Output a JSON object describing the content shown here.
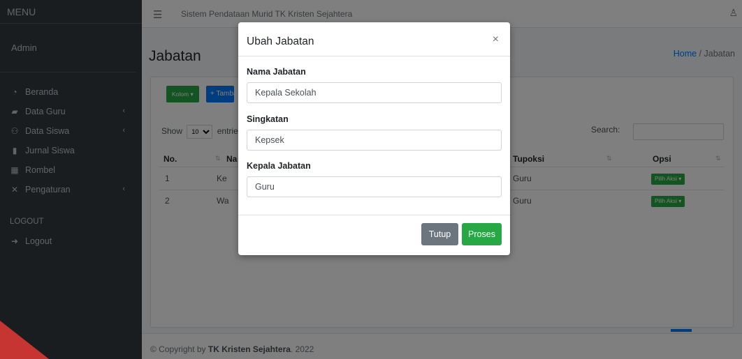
{
  "sidebar": {
    "menu_label": "MENU",
    "user": "Admin",
    "items": [
      {
        "label": "Beranda",
        "icon": "tachometer-icon",
        "chevron": ""
      },
      {
        "label": "Data Guru",
        "icon": "chalkboard-teacher-icon",
        "chevron": "‹"
      },
      {
        "label": "Data Siswa",
        "icon": "users-icon",
        "chevron": "‹"
      },
      {
        "label": "Jurnal Siswa",
        "icon": "file-icon",
        "chevron": ""
      },
      {
        "label": "Rombel",
        "icon": "building-icon",
        "chevron": ""
      },
      {
        "label": "Pengaturan",
        "icon": "tools-icon",
        "chevron": "‹"
      }
    ],
    "logout_header": "LOGOUT",
    "logout_label": "Logout"
  },
  "topbar": {
    "title": "Sistem Pendataan Murid TK Kristen Sejahtera"
  },
  "page": {
    "title": "Jabatan",
    "breadcrumb_home": "Home",
    "breadcrumb_sep": "/",
    "breadcrumb_current": "Jabatan"
  },
  "toolbar": {
    "kolom_label": "Kolom ▾",
    "tambah_label": "+ Tambah"
  },
  "table": {
    "show_label": "Show",
    "entries_value": "10",
    "entries_label": "entries",
    "search_label": "Search:",
    "headers": {
      "no": "No.",
      "nama": "Na",
      "tupoksi": "Tupoksi",
      "opsi": "Opsi"
    },
    "rows": [
      {
        "no": "1",
        "nama": "Ke",
        "tupoksi": "Guru",
        "aksi": "Pilih Aksi ▾"
      },
      {
        "no": "2",
        "nama": "Wa",
        "tupoksi": "Guru",
        "aksi": "Pilih Aksi ▾"
      }
    ]
  },
  "footer": {
    "prefix": "© Copyright by ",
    "brand": "TK Kristen Sejahtera",
    "suffix": ". 2022"
  },
  "modal": {
    "title": "Ubah Jabatan",
    "close": "×",
    "fields": [
      {
        "label": "Nama Jabatan",
        "value": "Kepala Sekolah"
      },
      {
        "label": "Singkatan",
        "value": "Kepsek"
      },
      {
        "label": "Kepala Jabatan",
        "value": "Guru"
      }
    ],
    "cancel_label": "Tutup",
    "submit_label": "Proses"
  }
}
